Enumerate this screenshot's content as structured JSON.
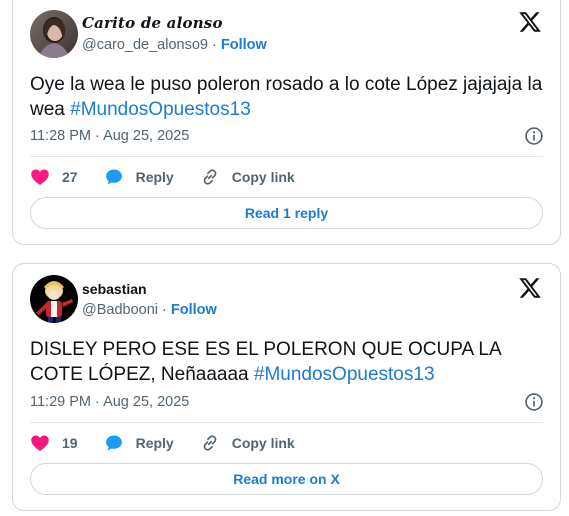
{
  "tweets": [
    {
      "display_name": "Carito de alonso",
      "handle": "@caro_de_alonso9",
      "follow_label": "Follow",
      "text": "Oye la wea le puso poleron rosado a lo cote López jajajaja la wea",
      "hashtag": "#MundosOpuestos13",
      "time": "11:28 PM · Aug 25, 2025",
      "likes": "27",
      "reply_label": "Reply",
      "copy_link_label": "Copy link",
      "bottom_button": "Read 1 reply",
      "avatar_icon": "woman-portrait-avatar"
    },
    {
      "display_name": "sebastian",
      "handle": "@Badbooni",
      "follow_label": "Follow",
      "text": "DISLEY PERO ESE ES EL POLERON QUE OCUPA LA COTE LÓPEZ, Neñaaaaa ",
      "hashtag": "#MundosOpuestos13",
      "time": "11:29 PM · Aug 25, 2025",
      "likes": "19",
      "reply_label": "Reply",
      "copy_link_label": "Copy link",
      "bottom_button": "Read more on X",
      "avatar_icon": "cartoon-character-avatar"
    }
  ],
  "colors": {
    "accent": "#1d7bd2",
    "like": "#f91880",
    "muted": "#536471",
    "text": "#0f1419",
    "border": "#cfd9de"
  }
}
